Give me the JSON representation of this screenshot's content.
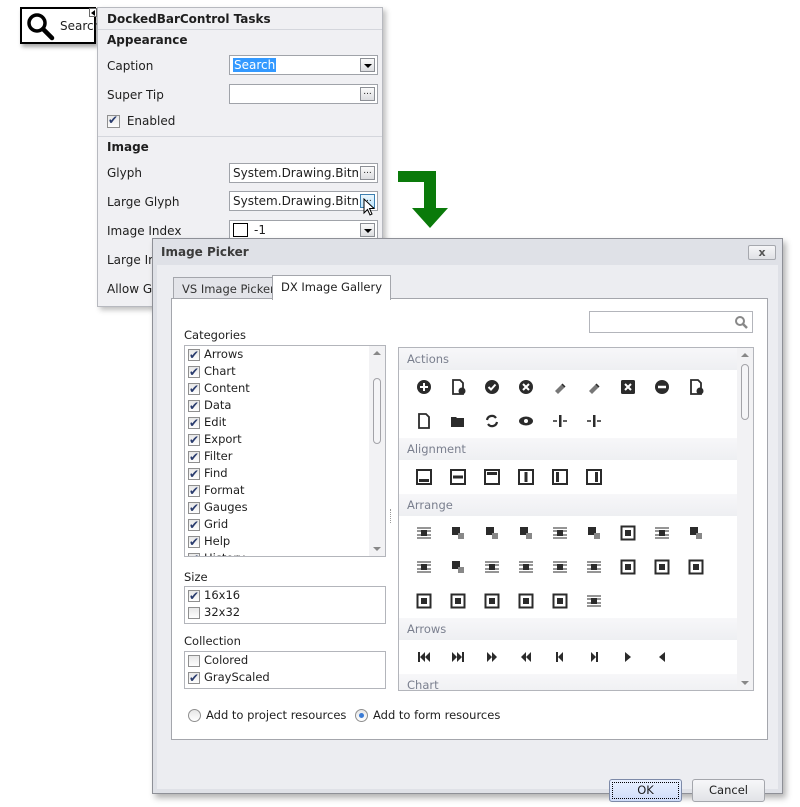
{
  "bar_item": {
    "caption": "Search",
    "icon": "magnifier-icon"
  },
  "tasks_panel": {
    "title": "DockedBarControl Tasks",
    "sections": {
      "appearance": "Appearance",
      "image": "Image"
    },
    "fields": {
      "caption": {
        "label": "Caption",
        "value": "Search"
      },
      "super_tip": {
        "label": "Super Tip",
        "value": ""
      },
      "enabled": {
        "label": "Enabled",
        "checked": true
      },
      "glyph": {
        "label": "Glyph",
        "value": "System.Drawing.Bitma"
      },
      "large_glyph": {
        "label": "Large Glyph",
        "value": "System.Drawing.Bitma"
      },
      "image_index": {
        "label": "Image Index",
        "value": "-1"
      },
      "large_image_index": {
        "label": "Large Im"
      },
      "allow_glyph": {
        "label": "Allow Gly"
      }
    },
    "ellipsis": "..."
  },
  "dialog": {
    "title": "Image Picker",
    "close": "x",
    "tabs": [
      {
        "label": "VS Image Picker",
        "active": false
      },
      {
        "label": "DX Image Gallery",
        "active": true
      }
    ],
    "search": {
      "placeholder": "",
      "value": ""
    },
    "categories": {
      "label": "Categories",
      "items": [
        {
          "label": "Arrows",
          "checked": true
        },
        {
          "label": "Chart",
          "checked": true
        },
        {
          "label": "Content",
          "checked": true
        },
        {
          "label": "Data",
          "checked": true
        },
        {
          "label": "Edit",
          "checked": true
        },
        {
          "label": "Export",
          "checked": true
        },
        {
          "label": "Filter",
          "checked": true
        },
        {
          "label": "Find",
          "checked": true
        },
        {
          "label": "Format",
          "checked": true
        },
        {
          "label": "Gauges",
          "checked": true
        },
        {
          "label": "Grid",
          "checked": true
        },
        {
          "label": "Help",
          "checked": true
        },
        {
          "label": "History",
          "checked": true
        }
      ]
    },
    "size": {
      "label": "Size",
      "items": [
        {
          "label": "16x16",
          "checked": true
        },
        {
          "label": "32x32",
          "checked": false
        }
      ]
    },
    "collection": {
      "label": "Collection",
      "items": [
        {
          "label": "Colored",
          "checked": false
        },
        {
          "label": "GrayScaled",
          "checked": true
        }
      ]
    },
    "gallery": {
      "groups": [
        {
          "name": "Actions",
          "rows": [
            [
              "add-icon",
              "new-document-add-icon",
              "apply-icon",
              "cancel-icon",
              "clear-icon",
              "clear-formatting-icon",
              "delete-icon",
              "remove-icon",
              "document-remove-icon"
            ],
            [
              "new-icon",
              "open-icon",
              "refresh-icon",
              "show-icon",
              "shrink-icon",
              "expand-icon"
            ]
          ]
        },
        {
          "name": "Alignment",
          "rows": [
            [
              "align-bottom-icon",
              "align-middle-icon",
              "align-top-icon",
              "align-center-icon",
              "align-left-icon",
              "align-right-icon"
            ]
          ]
        },
        {
          "name": "Arrange",
          "rows": [
            [
              "wrap-behind-text-icon",
              "bring-forward-icon",
              "bring-to-front-icon",
              "bring-to-front-of-text-icon",
              "edit-wrap-points-icon",
              "wrap-in-front-of-text-icon",
              "position-middle-center-icon",
              "square-wrap-icon",
              "send-backward-icon"
            ],
            [
              "send-behind-text-icon",
              "send-to-back-icon",
              "wrap-square-icon",
              "wrap-tight-icon",
              "wrap-through-icon",
              "wrap-top-bottom-icon",
              "position-top-center-icon",
              "position-top-left-icon",
              "position-top-right-icon"
            ],
            [
              "position-middle-left-icon",
              "position-middle-center-alt-icon",
              "position-bottom-center-icon",
              "position-bottom-left-icon",
              "position-bottom-right-icon",
              "with-text-wrapping-icon"
            ]
          ]
        },
        {
          "name": "Arrows",
          "rows": [
            [
              "first-icon",
              "last-icon",
              "double-next-icon",
              "double-prev-icon",
              "prev-bar-icon",
              "next-bar-icon",
              "next-icon",
              "prev-icon"
            ]
          ]
        },
        {
          "name": "Chart",
          "rows": []
        }
      ]
    },
    "radios": [
      {
        "label": "Add to project resources",
        "selected": false
      },
      {
        "label": "Add to form resources",
        "selected": true
      }
    ],
    "buttons": {
      "ok": "OK",
      "cancel": "Cancel"
    }
  }
}
